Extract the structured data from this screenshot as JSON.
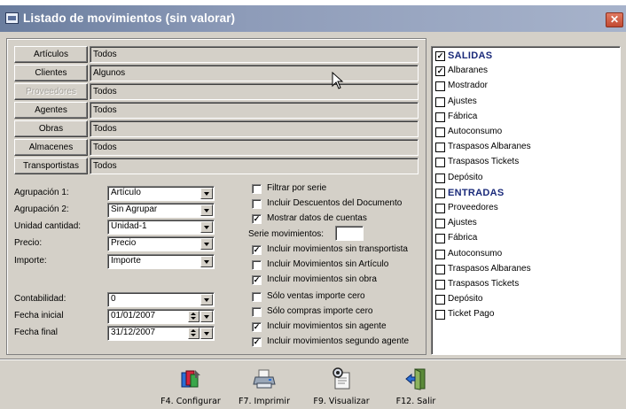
{
  "window": {
    "title": "Listado de movimientos (sin valorar)",
    "close_glyph": "✕"
  },
  "filters": [
    {
      "label": "Artículos",
      "value": "Todos",
      "disabled": false
    },
    {
      "label": "Clientes",
      "value": "Algunos",
      "disabled": false
    },
    {
      "label": "Proveedores",
      "value": "Todos",
      "disabled": true
    },
    {
      "label": "Agentes",
      "value": "Todos",
      "disabled": false
    },
    {
      "label": "Obras",
      "value": "Todos",
      "disabled": false
    },
    {
      "label": "Almacenes",
      "value": "Todos",
      "disabled": false
    },
    {
      "label": "Transportistas",
      "value": "Todos",
      "disabled": false
    }
  ],
  "form": {
    "agrupacion1": {
      "label": "Agrupación 1:",
      "value": "Artículo"
    },
    "agrupacion2": {
      "label": "Agrupación 2:",
      "value": "Sin Agrupar"
    },
    "unidad": {
      "label": "Unidad cantidad:",
      "value": "Unidad-1"
    },
    "precio": {
      "label": "Precio:",
      "value": "Precio"
    },
    "importe": {
      "label": "Importe:",
      "value": "Importe"
    },
    "contabilidad": {
      "label": "Contabilidad:",
      "value": "0"
    },
    "fecha_inicial": {
      "label": "Fecha inicial",
      "value": "01/01/2007"
    },
    "fecha_final": {
      "label": "Fecha final",
      "value": "31/12/2007"
    }
  },
  "options": {
    "filtrar_serie": {
      "label": "Filtrar por serie",
      "checked": false
    },
    "incluir_descuentos": {
      "label": "Incluir Descuentos del Documento",
      "checked": false
    },
    "mostrar_cuentas": {
      "label": "Mostrar datos de cuentas",
      "checked": true
    },
    "serie_label": "Serie movimientos:",
    "serie_value": "",
    "sin_transportista": {
      "label": "Incluir movimientos sin transportista",
      "checked": true
    },
    "sin_articulo": {
      "label": "Incluir Movimientos sin Artículo",
      "checked": false
    },
    "sin_obra": {
      "label": "Incluir movimientos sin obra",
      "checked": true
    },
    "ventas_cero": {
      "label": "Sólo ventas importe cero",
      "checked": false
    },
    "compras_cero": {
      "label": "Sólo compras importe cero",
      "checked": false
    },
    "sin_agente": {
      "label": "Incluir movimientos sin agente",
      "checked": true
    },
    "segundo_agente": {
      "label": "Incluir movimientos segundo agente",
      "checked": true
    }
  },
  "types_list": [
    {
      "label": "SALIDAS",
      "checked": true,
      "header": true
    },
    {
      "label": "Albaranes",
      "checked": true,
      "header": false
    },
    {
      "label": "Mostrador",
      "checked": false,
      "header": false
    },
    {
      "label": "Ajustes",
      "checked": false,
      "header": false
    },
    {
      "label": "Fábrica",
      "checked": false,
      "header": false
    },
    {
      "label": "Autoconsumo",
      "checked": false,
      "header": false
    },
    {
      "label": "Traspasos Albaranes",
      "checked": false,
      "header": false
    },
    {
      "label": "Traspasos Tickets",
      "checked": false,
      "header": false
    },
    {
      "label": "Depósito",
      "checked": false,
      "header": false
    },
    {
      "label": "ENTRADAS",
      "checked": false,
      "header": true
    },
    {
      "label": "Proveedores",
      "checked": false,
      "header": false
    },
    {
      "label": "Ajustes",
      "checked": false,
      "header": false
    },
    {
      "label": "Fábrica",
      "checked": false,
      "header": false
    },
    {
      "label": "Autoconsumo",
      "checked": false,
      "header": false
    },
    {
      "label": "Traspasos Albaranes",
      "checked": false,
      "header": false
    },
    {
      "label": "Traspasos Tickets",
      "checked": false,
      "header": false
    },
    {
      "label": "Depósito",
      "checked": false,
      "header": false
    },
    {
      "label": "Ticket Pago",
      "checked": false,
      "header": false
    }
  ],
  "toolbar": {
    "configurar": "F4. Configurar",
    "imprimir": "F7. Imprimir",
    "visualizar": "F9. Visualizar",
    "salir": "F12. Salir"
  },
  "check_glyph": "✓"
}
